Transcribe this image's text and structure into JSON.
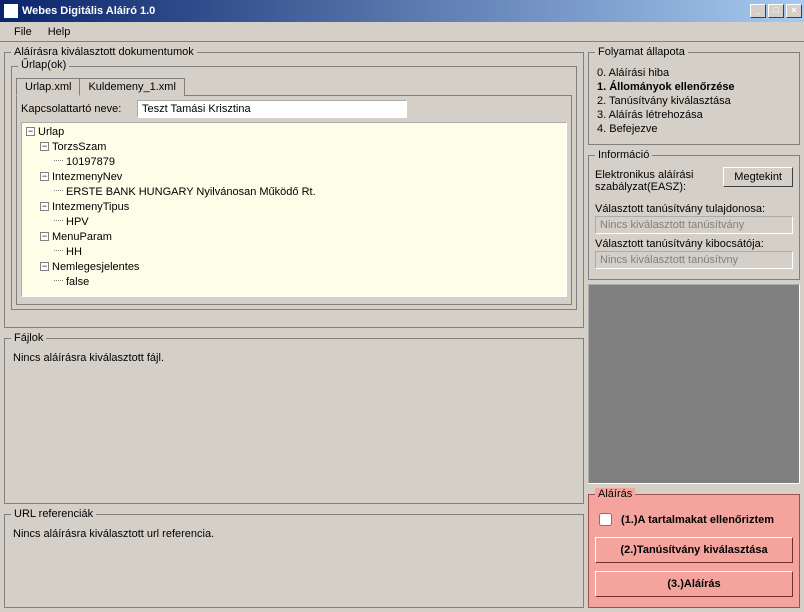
{
  "window": {
    "title": "Webes Digitális Aláíró 1.0",
    "min": "_",
    "max": "□",
    "close": "×"
  },
  "menu": {
    "file": "File",
    "help": "Help"
  },
  "docs": {
    "legend": "Aláírásra kiválasztott dokumentumok",
    "formsLegend": "Űrlap(ok)",
    "tabs": {
      "t1": "Urlap.xml",
      "t2": "Kuldemeny_1.xml"
    },
    "contactLabel": "Kapcsolattartó neve:",
    "contactValue": "Teszt Tamási Krisztina",
    "tree": {
      "root": "Urlap",
      "n1": "TorzsSzam",
      "n1v": "10197879",
      "n2": "IntezmenyNev",
      "n2v": "ERSTE BANK HUNGARY Nyilvánosan Működő Rt.",
      "n3": "IntezmenyTipus",
      "n3v": "HPV",
      "n4": "MenuParam",
      "n4v": "HH",
      "n5": "Nemlegesjelentes",
      "n5v": "false"
    }
  },
  "files": {
    "legend": "Fájlok",
    "empty": "Nincs aláírásra kiválasztott fájl."
  },
  "url": {
    "legend": "URL referenciák",
    "empty": "Nincs aláírásra kiválasztott url referencia."
  },
  "process": {
    "legend": "Folyamat állapota",
    "s0": "0. Aláírási hiba",
    "s1": "1. Állományok ellenőrzése",
    "s2": "2. Tanúsítvány kiválasztása",
    "s3": "3. Aláírás létrehozása",
    "s4": "4. Befejezve"
  },
  "info": {
    "legend": "Információ",
    "easzText": "Elektronikus aláírási szabályzat(EASZ):",
    "viewBtn": "Megtekint",
    "ownerLabel": "Választott tanúsítvány tulajdonosa:",
    "ownerValue": "Nincs kiválasztott tanúsítvány",
    "issuerLabel": "Választott tanúsítvány kibocsátója:",
    "issuerValue": "Nincs kiválasztott tanúsítvny"
  },
  "sign": {
    "legend": "Aláírás",
    "check": "(1.)A tartalmakat ellenőriztem",
    "btn2": "(2.)Tanúsítvány kiválasztása",
    "btn3": "(3.)Aláírás"
  }
}
